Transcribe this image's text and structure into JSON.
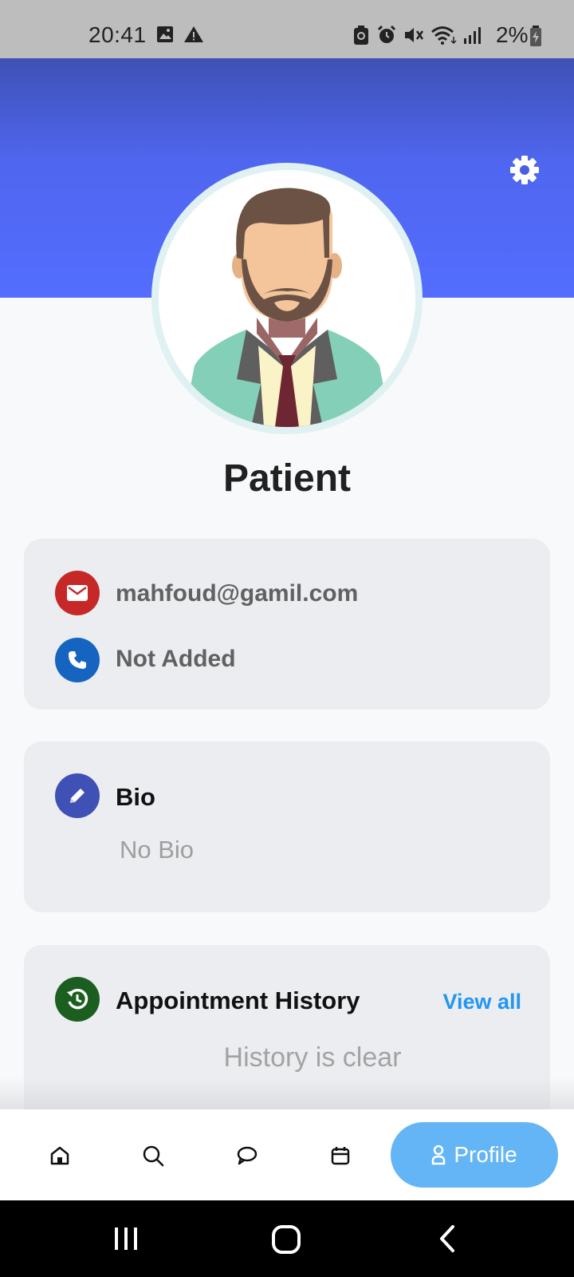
{
  "status_bar": {
    "time": "20:41",
    "battery_percent": "2%",
    "left_icons": [
      "image-icon",
      "warning-icon"
    ],
    "right_icons": [
      "battery-saver-icon",
      "alarm-icon",
      "mute-icon",
      "wifi-icon",
      "signal-icon",
      "battery-charging-icon"
    ]
  },
  "header": {
    "color_top": "#3f51b5",
    "color_bottom": "#536dfe",
    "settings_icon": "gear-icon"
  },
  "profile": {
    "title": "Patient",
    "avatar_icon": "doctor-avatar-illustration"
  },
  "contact": {
    "email": "mahfoud@gamil.com",
    "email_icon_color": "#c62828",
    "phone": "Not Added",
    "phone_icon_color": "#1565c0"
  },
  "bio": {
    "heading": "Bio",
    "text": "No Bio",
    "icon_color": "#3f51b5"
  },
  "history": {
    "heading": "Appointment History",
    "view_all": "View all",
    "empty_text": "History is clear",
    "icon_color": "#1b5e20"
  },
  "bottom_nav": {
    "items": [
      "home-icon",
      "search-icon",
      "chat-icon",
      "calendar-icon"
    ],
    "active_label": "Profile",
    "active_color": "#64b5f6"
  },
  "system_nav": [
    "recents-button",
    "home-button",
    "back-button"
  ]
}
